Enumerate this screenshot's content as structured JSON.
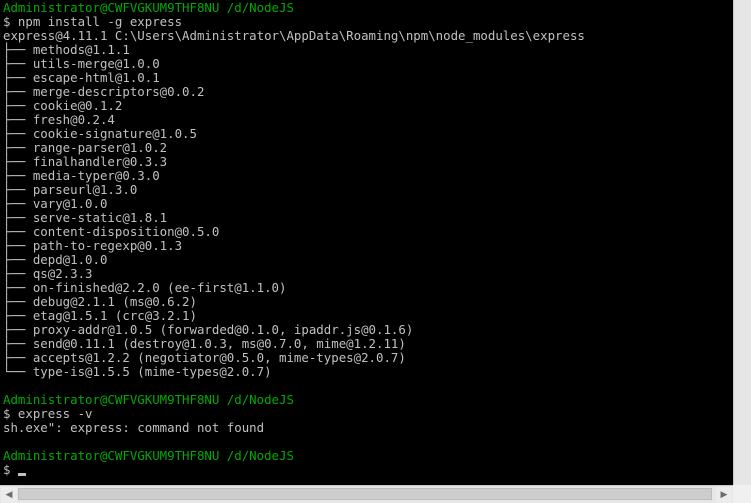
{
  "terminal": {
    "lines": [
      {
        "text": "Administrator@CWFVGKUM9THF8NU /d/NodeJS",
        "kind": "prompt"
      },
      {
        "text": "$ npm install -g express",
        "kind": "output"
      },
      {
        "text": "express@4.11.1 C:\\Users\\Administrator\\AppData\\Roaming\\npm\\node_modules\\express",
        "kind": "output"
      },
      {
        "text": "├── methods@1.1.1",
        "kind": "output"
      },
      {
        "text": "├── utils-merge@1.0.0",
        "kind": "output"
      },
      {
        "text": "├── escape-html@1.0.1",
        "kind": "output"
      },
      {
        "text": "├── merge-descriptors@0.0.2",
        "kind": "output"
      },
      {
        "text": "├── cookie@0.1.2",
        "kind": "output"
      },
      {
        "text": "├── fresh@0.2.4",
        "kind": "output"
      },
      {
        "text": "├── cookie-signature@1.0.5",
        "kind": "output"
      },
      {
        "text": "├── range-parser@1.0.2",
        "kind": "output"
      },
      {
        "text": "├── finalhandler@0.3.3",
        "kind": "output"
      },
      {
        "text": "├── media-typer@0.3.0",
        "kind": "output"
      },
      {
        "text": "├── parseurl@1.3.0",
        "kind": "output"
      },
      {
        "text": "├── vary@1.0.0",
        "kind": "output"
      },
      {
        "text": "├── serve-static@1.8.1",
        "kind": "output"
      },
      {
        "text": "├── content-disposition@0.5.0",
        "kind": "output"
      },
      {
        "text": "├── path-to-regexp@0.1.3",
        "kind": "output"
      },
      {
        "text": "├── depd@1.0.0",
        "kind": "output"
      },
      {
        "text": "├── qs@2.3.3",
        "kind": "output"
      },
      {
        "text": "├── on-finished@2.2.0 (ee-first@1.1.0)",
        "kind": "output"
      },
      {
        "text": "├── debug@2.1.1 (ms@0.6.2)",
        "kind": "output"
      },
      {
        "text": "├── etag@1.5.1 (crc@3.2.1)",
        "kind": "output"
      },
      {
        "text": "├── proxy-addr@1.0.5 (forwarded@0.1.0, ipaddr.js@0.1.6)",
        "kind": "output"
      },
      {
        "text": "├── send@0.11.1 (destroy@1.0.3, ms@0.7.0, mime@1.2.11)",
        "kind": "output"
      },
      {
        "text": "├── accepts@1.2.2 (negotiator@0.5.0, mime-types@2.0.7)",
        "kind": "output"
      },
      {
        "text": "└── type-is@1.5.5 (mime-types@2.0.7)",
        "kind": "output"
      },
      {
        "text": "",
        "kind": "blank"
      },
      {
        "text": "Administrator@CWFVGKUM9THF8NU /d/NodeJS",
        "kind": "prompt"
      },
      {
        "text": "$ express -v",
        "kind": "output"
      },
      {
        "text": "sh.exe\": express: command not found",
        "kind": "output"
      },
      {
        "text": "",
        "kind": "blank"
      },
      {
        "text": "Administrator@CWFVGKUM9THF8NU /d/NodeJS",
        "kind": "prompt"
      },
      {
        "text": "$",
        "kind": "input"
      }
    ],
    "colors": {
      "background": "#000000",
      "text": "#c0c0c0",
      "prompt": "#00aa00"
    }
  },
  "scrollbars": {
    "left_arrow": "◀",
    "right_arrow": "▶"
  }
}
